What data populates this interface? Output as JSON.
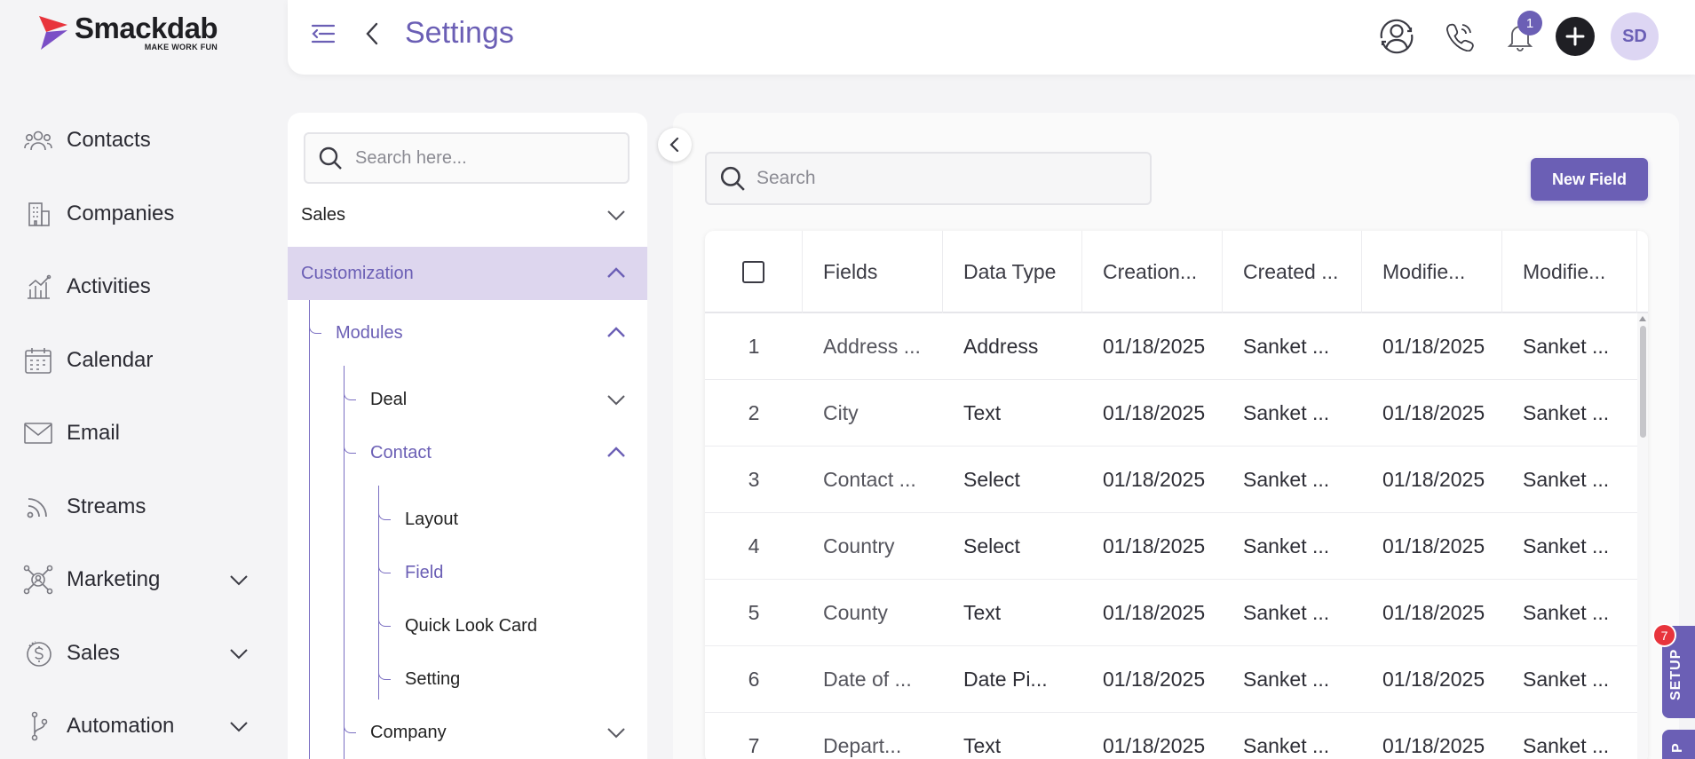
{
  "brand": {
    "name": "Smackdab",
    "tagline": "MAKE WORK FUN",
    "colors": {
      "accent": "#6b5fb5",
      "logo_red": "#e8343c",
      "logo_purple": "#7b4fc6"
    }
  },
  "sidebar": {
    "items": [
      {
        "label": "Contacts",
        "icon": "contacts-icon",
        "expandable": false
      },
      {
        "label": "Companies",
        "icon": "companies-icon",
        "expandable": false
      },
      {
        "label": "Activities",
        "icon": "activities-icon",
        "expandable": false
      },
      {
        "label": "Calendar",
        "icon": "calendar-icon",
        "expandable": false
      },
      {
        "label": "Email",
        "icon": "email-icon",
        "expandable": false
      },
      {
        "label": "Streams",
        "icon": "streams-icon",
        "expandable": false
      },
      {
        "label": "Marketing",
        "icon": "marketing-icon",
        "expandable": true
      },
      {
        "label": "Sales",
        "icon": "sales-icon",
        "expandable": true
      },
      {
        "label": "Automation",
        "icon": "automation-icon",
        "expandable": true
      }
    ]
  },
  "header": {
    "title": "Settings",
    "notification_count": "1",
    "avatar_initials": "SD",
    "icons": [
      "menu-toggle-icon",
      "back-icon",
      "support-icon",
      "phone-icon",
      "bell-icon",
      "plus-icon"
    ]
  },
  "settings_tree": {
    "search_placeholder": "Search here...",
    "items": [
      {
        "label": "Sales",
        "state": "collapsed"
      },
      {
        "label": "Customization",
        "state": "expanded",
        "active": true
      },
      {
        "label": "Modules",
        "state": "expanded"
      },
      {
        "label": "Deal",
        "state": "collapsed"
      },
      {
        "label": "Contact",
        "state": "expanded"
      },
      {
        "label": "Layout"
      },
      {
        "label": "Field",
        "selected": true
      },
      {
        "label": "Quick Look Card"
      },
      {
        "label": "Setting"
      },
      {
        "label": "Company",
        "state": "collapsed"
      }
    ]
  },
  "main": {
    "search_placeholder": "Search",
    "new_field_label": "New Field",
    "table": {
      "columns": [
        "Fields",
        "Data Type",
        "Creation...",
        "Created ...",
        "Modifie...",
        "Modifie..."
      ],
      "rows": [
        {
          "num": "1",
          "field": "Address ...",
          "type": "Address",
          "created_on": "01/18/2025",
          "created_by": "Sanket ...",
          "modified_on": "01/18/2025",
          "modified_by": "Sanket ..."
        },
        {
          "num": "2",
          "field": "City",
          "type": "Text",
          "created_on": "01/18/2025",
          "created_by": "Sanket ...",
          "modified_on": "01/18/2025",
          "modified_by": "Sanket ..."
        },
        {
          "num": "3",
          "field": "Contact ...",
          "type": "Select",
          "created_on": "01/18/2025",
          "created_by": "Sanket ...",
          "modified_on": "01/18/2025",
          "modified_by": "Sanket ..."
        },
        {
          "num": "4",
          "field": "Country",
          "type": "Select",
          "created_on": "01/18/2025",
          "created_by": "Sanket ...",
          "modified_on": "01/18/2025",
          "modified_by": "Sanket ..."
        },
        {
          "num": "5",
          "field": "County",
          "type": "Text",
          "created_on": "01/18/2025",
          "created_by": "Sanket ...",
          "modified_on": "01/18/2025",
          "modified_by": "Sanket ..."
        },
        {
          "num": "6",
          "field": "Date of ...",
          "type": "Date Pi...",
          "created_on": "01/18/2025",
          "created_by": "Sanket ...",
          "modified_on": "01/18/2025",
          "modified_by": "Sanket ..."
        },
        {
          "num": "7",
          "field": "Depart...",
          "type": "Text",
          "created_on": "01/18/2025",
          "created_by": "Sanket ...",
          "modified_on": "01/18/2025",
          "modified_by": "Sanket ..."
        }
      ]
    }
  },
  "setup_tab": {
    "label": "SETUP",
    "badge": "7"
  },
  "p_tab": {
    "label": "P"
  }
}
